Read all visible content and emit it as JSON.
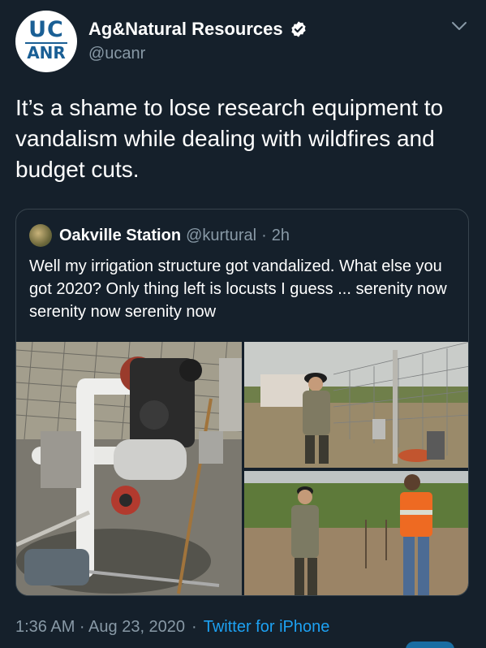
{
  "tweet": {
    "avatar_text_top": "UC",
    "avatar_text_bottom": "ANR",
    "display_name": "Ag&Natural Resources",
    "handle": "@ucanr",
    "text": "It’s a shame to lose research equipment to vandalism while dealing with wildfires and budget cuts.",
    "timestamp": "1:36 AM · Aug 23, 2020",
    "separator": "·",
    "source": "Twitter for iPhone",
    "verified": true
  },
  "quoted_tweet": {
    "display_name": "Oakville Station",
    "handle": "@kurtural",
    "separator": "·",
    "time": "2h",
    "text": "Well my irrigation structure got vandalized. What else you got 2020? Only thing left is locusts I guess ... serenity now serenity now serenity now",
    "photos": [
      "irrigation-equipment-photo",
      "officer-at-fence-photo",
      "officer-and-worker-vineyard-photo"
    ]
  },
  "icons": {
    "verified": "verified-badge-icon",
    "menu": "chevron-down-icon"
  },
  "colors": {
    "background": "#15202b",
    "text_primary": "#ffffff",
    "text_secondary": "#8899a6",
    "link": "#1da1f2",
    "border": "#38444d",
    "brand": "#1a5f95"
  }
}
